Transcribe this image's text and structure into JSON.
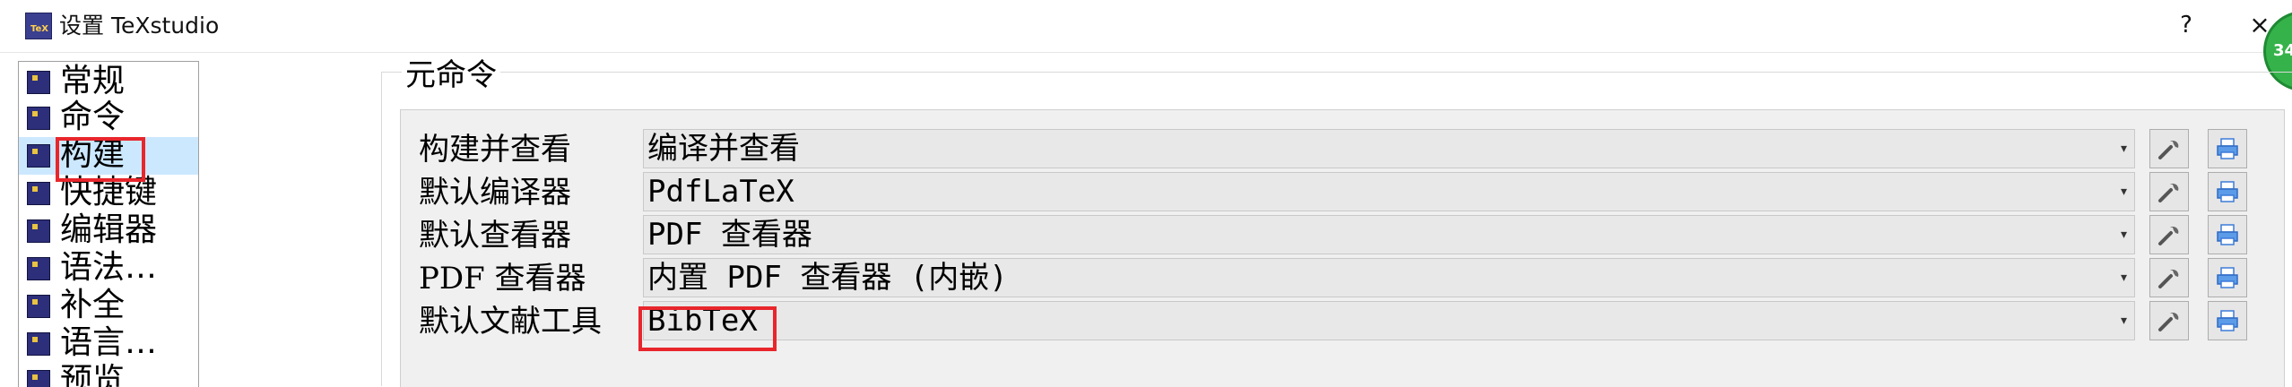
{
  "window": {
    "title": "设置 TeXstudio",
    "icon": "texstudio-app-icon",
    "help_label": "?",
    "close_label": "×",
    "badge_text": "34"
  },
  "nav": {
    "items": [
      {
        "label": "常规",
        "icon": "general-settings-icon"
      },
      {
        "label": "命令",
        "icon": "commands-icon"
      },
      {
        "label": "构建",
        "icon": "build-icon",
        "selected": true
      },
      {
        "label": "快捷键",
        "icon": "shortcuts-icon"
      },
      {
        "label": "编辑器",
        "icon": "editor-icon"
      },
      {
        "label": "语法…",
        "icon": "syntax-icon"
      },
      {
        "label": "补全",
        "icon": "completion-icon"
      },
      {
        "label": "语言…",
        "icon": "language-icon"
      },
      {
        "label": "预览",
        "icon": "preview-icon"
      }
    ]
  },
  "meta_commands": {
    "group_title": "元命令",
    "rows": [
      {
        "label": "构建并查看",
        "value": "编译并查看"
      },
      {
        "label": "默认编译器",
        "value": "PdfLaTeX"
      },
      {
        "label": "默认查看器",
        "value": "PDF 查看器"
      },
      {
        "label": "PDF 查看器",
        "value": "内置 PDF 查看器 (内嵌)"
      },
      {
        "label": "默认文献工具",
        "value": "BibTeX"
      }
    ]
  },
  "colors": {
    "highlight": "#e8262c",
    "selection": "#cce8ff",
    "panel_bg": "#f0f0f0"
  }
}
